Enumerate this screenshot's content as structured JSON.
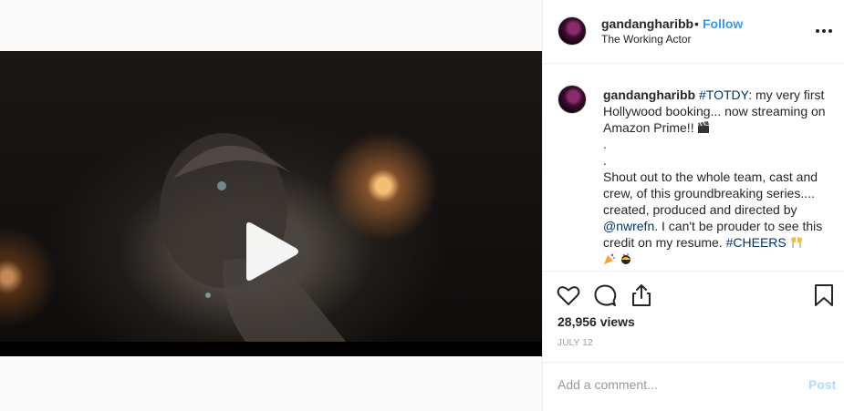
{
  "post": {
    "author": {
      "username": "gandangharibb",
      "avatar_icon": "profile-photo"
    },
    "follow_label": "Follow",
    "separator": "•",
    "location": "The Working Actor",
    "caption": {
      "part1": ": my very first Hollywood booking... now streaming on Amazon Prime!!",
      "hashtag1": "#TOTDY",
      "dot1": ".",
      "dot2": ".",
      "part2": "Shout out to the whole team, cast and crew, of this groundbreaking series.... created, produced and directed by ",
      "mention": "@nwrefn",
      "part3": ". I can't be prouder to see this credit on my resume. ",
      "hashtag2": "#CHEERS"
    },
    "views": "28,956 views",
    "date": "JULY 12"
  },
  "video": {
    "play_icon": "play-icon"
  },
  "comment": {
    "placeholder": "Add a comment...",
    "post_label": "Post"
  },
  "colors": {
    "link": "#3897f0",
    "hashtag": "#003569",
    "post_disabled": "#b3dbff",
    "muted": "#999999"
  }
}
